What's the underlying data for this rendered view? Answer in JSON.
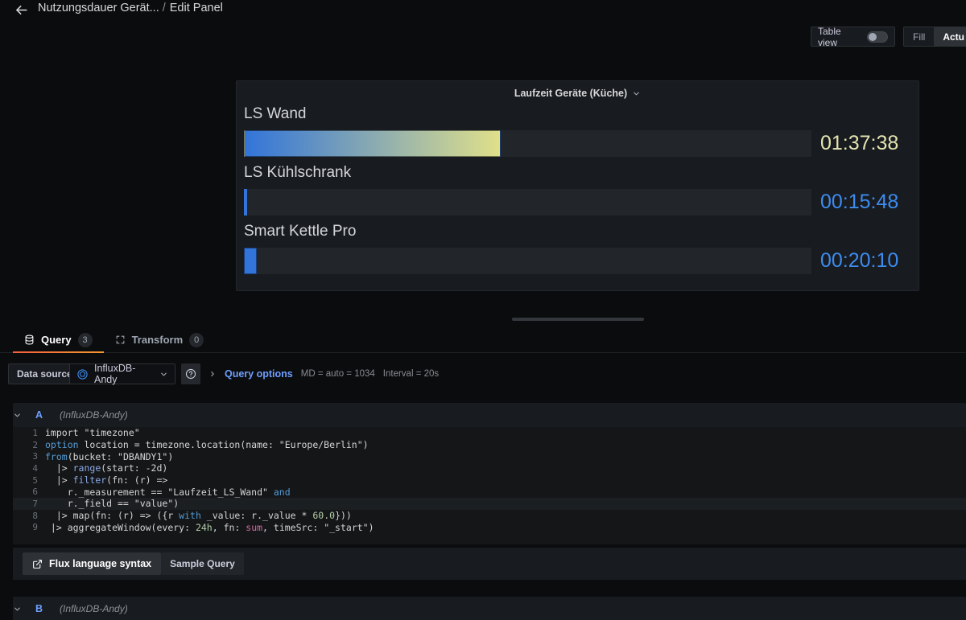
{
  "topbar": {
    "back_icon": "arrow-left-icon",
    "dashboard_title": "Nutzungsdauer Gerät...",
    "separator": "/",
    "page_title": "Edit Panel"
  },
  "header_controls": {
    "table_view_label": "Table view",
    "table_view_on": false,
    "segmented": [
      {
        "label": "Fill",
        "active": false
      },
      {
        "label": "Actu",
        "active": true
      }
    ]
  },
  "panel": {
    "title": "Laufzeit Geräte (Küche)",
    "menu_icon": "chevron-down-icon",
    "type": "bargauge",
    "track_color": "#222529",
    "rows": [
      {
        "label": "LS Wand",
        "value": "01:37:38",
        "fill_percent": 45.2,
        "fill_style": "gradient",
        "gradient_from": "#3274d9",
        "gradient_to": "#e0e08a",
        "value_color": "#e4e4b0"
      },
      {
        "label": "LS Kühlschrank",
        "value": "00:15:48",
        "fill_percent": 0.5,
        "fill_style": "solid",
        "gradient_from": "#3274d9",
        "gradient_to": "#3274d9",
        "value_color": "#3d8cf0"
      },
      {
        "label": "Smart Kettle Pro",
        "value": "00:20:10",
        "fill_percent": 2.3,
        "fill_style": "solid",
        "gradient_from": "#3274d9",
        "gradient_to": "#3274d9",
        "value_color": "#3d8cf0"
      }
    ]
  },
  "tabs": [
    {
      "label": "Query",
      "badge": "3",
      "icon": "database-icon",
      "active": true
    },
    {
      "label": "Transform",
      "badge": "0",
      "icon": "transform-icon",
      "active": false
    }
  ],
  "datasource_row": {
    "label": "Data source",
    "selected": "InfluxDB-Andy",
    "datasource_icon": "influxdb-icon",
    "caret_icon": "chevron-down-icon",
    "help_icon": "help-circle-icon",
    "query_options_caret": "chevron-right-icon",
    "query_options_label": "Query options",
    "max_data_points": "MD = auto = 1034",
    "interval": "Interval = 20s"
  },
  "queries": [
    {
      "ref_id": "A",
      "datasource": "(InfluxDB-Andy)",
      "collapse_icon": "chevron-down-icon"
    },
    {
      "ref_id": "B",
      "datasource": "(InfluxDB-Andy)",
      "collapse_icon": "chevron-down-icon"
    }
  ],
  "editor": {
    "language": "flux",
    "current_line": 7,
    "lines": [
      {
        "n": "1",
        "segments": [
          {
            "t": "import \"timezone\"",
            "c": ""
          }
        ]
      },
      {
        "n": "2",
        "segments": [
          {
            "t": "option",
            "c": "k-kw"
          },
          {
            "t": " location = timezone.location(name: \"Europe/Berlin\")",
            "c": ""
          }
        ]
      },
      {
        "n": "3",
        "segments": [
          {
            "t": "from",
            "c": "k-kw"
          },
          {
            "t": "(bucket: \"DBANDY1\")",
            "c": ""
          }
        ]
      },
      {
        "n": "4",
        "segments": [
          {
            "t": "  |> ",
            "c": ""
          },
          {
            "t": "range",
            "c": "k-fn"
          },
          {
            "t": "(start: -2d)",
            "c": ""
          }
        ]
      },
      {
        "n": "5",
        "segments": [
          {
            "t": "  |> ",
            "c": ""
          },
          {
            "t": "filter",
            "c": "k-fn"
          },
          {
            "t": "(fn: (r) =>",
            "c": ""
          }
        ]
      },
      {
        "n": "6",
        "segments": [
          {
            "t": "    r._measurement == \"Laufzeit_LS_Wand\" ",
            "c": ""
          },
          {
            "t": "and",
            "c": "k-kw"
          }
        ]
      },
      {
        "n": "7",
        "segments": [
          {
            "t": "    r._field == \"value\")",
            "c": ""
          }
        ]
      },
      {
        "n": "8",
        "segments": [
          {
            "t": "  |> map(fn: (r) => ({r ",
            "c": ""
          },
          {
            "t": "with",
            "c": "k-kw"
          },
          {
            "t": " _value: r._value * ",
            "c": ""
          },
          {
            "t": "60.0",
            "c": "k-num"
          },
          {
            "t": "}))",
            "c": ""
          }
        ]
      },
      {
        "n": "9",
        "segments": [
          {
            "t": " |> aggregateWindow(every: ",
            "c": ""
          },
          {
            "t": "24h",
            "c": "k-num"
          },
          {
            "t": ", fn: ",
            "c": ""
          },
          {
            "t": "sum",
            "c": "k-agg"
          },
          {
            "t": ", timeSrc: \"_start\")",
            "c": ""
          }
        ]
      }
    ],
    "footer": {
      "flux_link_label": "Flux language syntax",
      "flux_link_icon": "external-link-icon",
      "sample_query_label": "Sample Query"
    }
  }
}
